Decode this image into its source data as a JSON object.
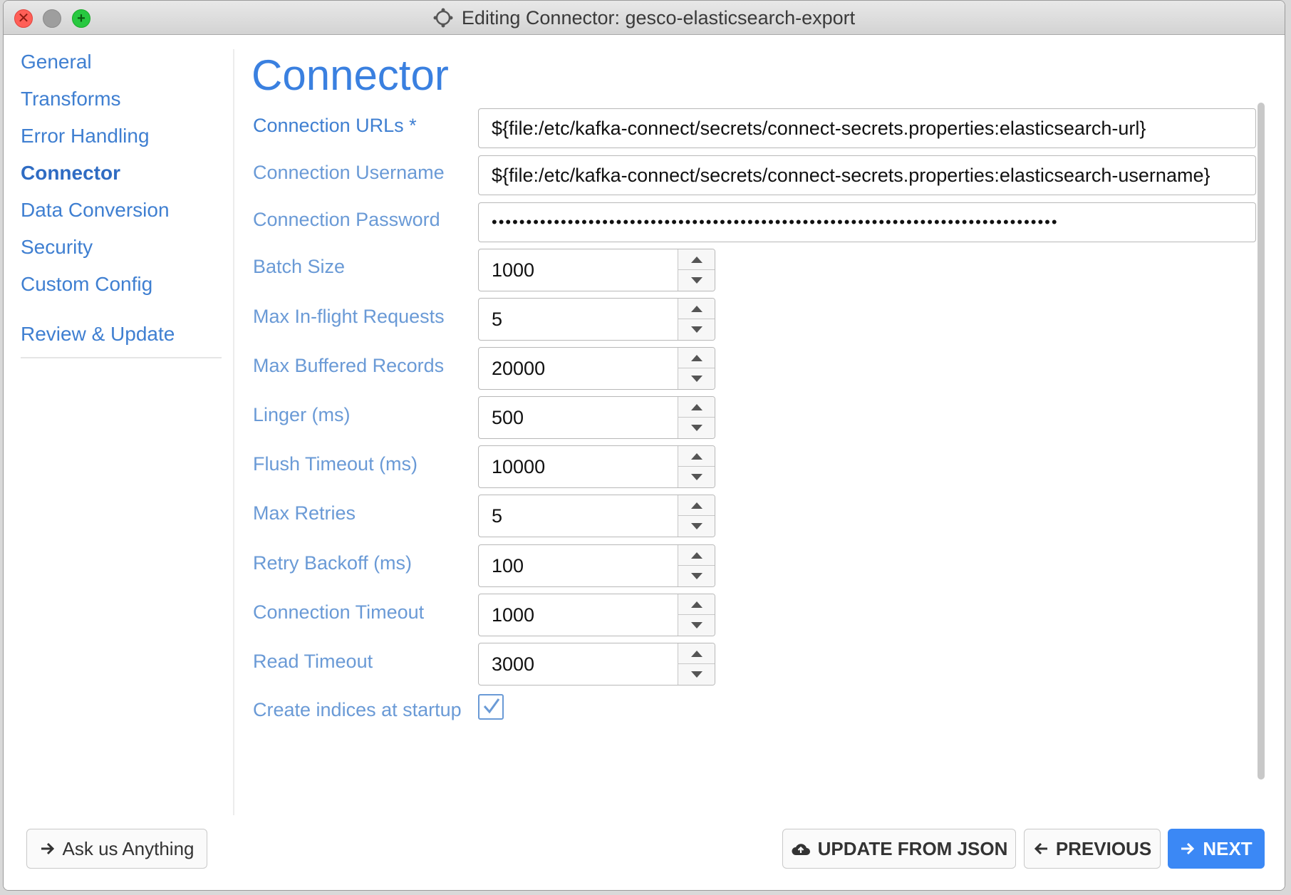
{
  "window": {
    "title": "Editing Connector: gesco-elasticsearch-export",
    "close_glyph": "✕",
    "zoom_glyph": "+"
  },
  "sidebar": {
    "items": [
      {
        "label": "General",
        "active": false
      },
      {
        "label": "Transforms",
        "active": false
      },
      {
        "label": "Error Handling",
        "active": false
      },
      {
        "label": "Connector",
        "active": true
      },
      {
        "label": "Data Conversion",
        "active": false
      },
      {
        "label": "Security",
        "active": false
      },
      {
        "label": "Custom Config",
        "active": false
      },
      {
        "label": "Review & Update",
        "active": false
      }
    ]
  },
  "main": {
    "title": "Connector",
    "fields": {
      "connection_urls": {
        "label": "Connection URLs *",
        "value": "${file:/etc/kafka-connect/secrets/connect-secrets.properties:elasticsearch-url}"
      },
      "connection_username": {
        "label": "Connection Username",
        "value": "${file:/etc/kafka-connect/secrets/connect-secrets.properties:elasticsearch-username}"
      },
      "connection_password": {
        "label": "Connection Password",
        "value": "••••••••••••••••••••••••••••••••••••••••••••••••••••••••••••••••••••••••••••••••••"
      },
      "batch_size": {
        "label": "Batch Size",
        "value": "1000"
      },
      "max_inflight": {
        "label": "Max In-flight Requests",
        "value": "5"
      },
      "max_buffered": {
        "label": "Max Buffered Records",
        "value": "20000"
      },
      "linger": {
        "label": "Linger (ms)",
        "value": "500"
      },
      "flush_timeout": {
        "label": "Flush Timeout (ms)",
        "value": "10000"
      },
      "max_retries": {
        "label": "Max Retries",
        "value": "5"
      },
      "retry_backoff": {
        "label": "Retry Backoff (ms)",
        "value": "100"
      },
      "connection_timeout": {
        "label": "Connection Timeout",
        "value": "1000"
      },
      "read_timeout": {
        "label": "Read Timeout",
        "value": "3000"
      },
      "create_indices": {
        "label": "Create indices at startup",
        "checked": true
      }
    }
  },
  "footer": {
    "ask_label": "Ask us Anything",
    "update_json_label": "UPDATE FROM JSON",
    "previous_label": "PREVIOUS",
    "next_label": "NEXT"
  },
  "colors": {
    "accent": "#3b88f5",
    "link": "#3f7fd1",
    "label": "#6a9ad6"
  }
}
